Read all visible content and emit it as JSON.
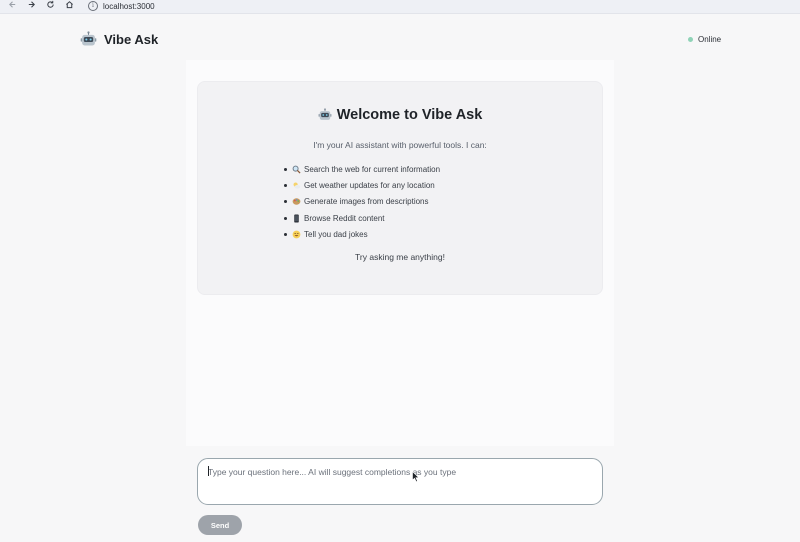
{
  "browser": {
    "url": "localhost:3000",
    "icons": [
      "back-arrow-icon",
      "forward-arrow-icon",
      "reload-icon",
      "home-icon",
      "info-icon"
    ]
  },
  "header": {
    "title": "Vibe Ask",
    "brand_icon": "robot-icon",
    "status_label": "Online",
    "status_color": "#8fd3b7"
  },
  "welcome": {
    "title": "Welcome to Vibe Ask",
    "icon": "robot-icon",
    "subtitle": "I'm your AI assistant with powerful tools. I can:",
    "capabilities": [
      {
        "icon": "magnifying-glass-icon",
        "label": "Search the web for current information"
      },
      {
        "icon": "weather-icon",
        "label": "Get weather updates for any location"
      },
      {
        "icon": "palette-icon",
        "label": "Generate images from descriptions"
      },
      {
        "icon": "phone-icon",
        "label": "Browse Reddit content"
      },
      {
        "icon": "laughing-face-icon",
        "label": "Tell you dad jokes"
      }
    ],
    "footer": "Try asking me anything!"
  },
  "composer": {
    "value": "",
    "placeholder": "Type your question here... AI will suggest completions as you type",
    "border_color": "#9aa7ae"
  },
  "send_button": {
    "label": "Send",
    "color": "#9ea3aa"
  }
}
